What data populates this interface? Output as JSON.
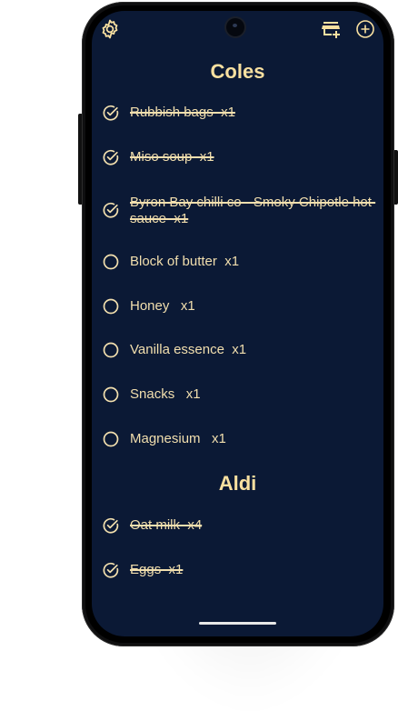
{
  "colors": {
    "background": "#0b1935",
    "text": "#f2dfae",
    "accent": "#f9e0a0"
  },
  "toolbar": {
    "settings_icon": "gear-icon",
    "add_store_icon": "store-add-icon",
    "add_item_icon": "plus-circle-icon"
  },
  "lists": [
    {
      "store": "Coles",
      "items": [
        {
          "name": "Rubbish bags  x1",
          "checked": true
        },
        {
          "name": "Miso soup  x1",
          "checked": true
        },
        {
          "name": "Byron Bay chilli co - Smoky Chipotle hot sauce  x1",
          "checked": true
        },
        {
          "name": "Block of butter  x1",
          "checked": false
        },
        {
          "name": "Honey   x1",
          "checked": false
        },
        {
          "name": "Vanilla essence  x1",
          "checked": false
        },
        {
          "name": "Snacks   x1",
          "checked": false
        },
        {
          "name": "Magnesium   x1",
          "checked": false
        }
      ]
    },
    {
      "store": "Aldi",
      "items": [
        {
          "name": "Oat milk  x4",
          "checked": true
        },
        {
          "name": "Eggs  x1",
          "checked": true
        }
      ]
    }
  ]
}
